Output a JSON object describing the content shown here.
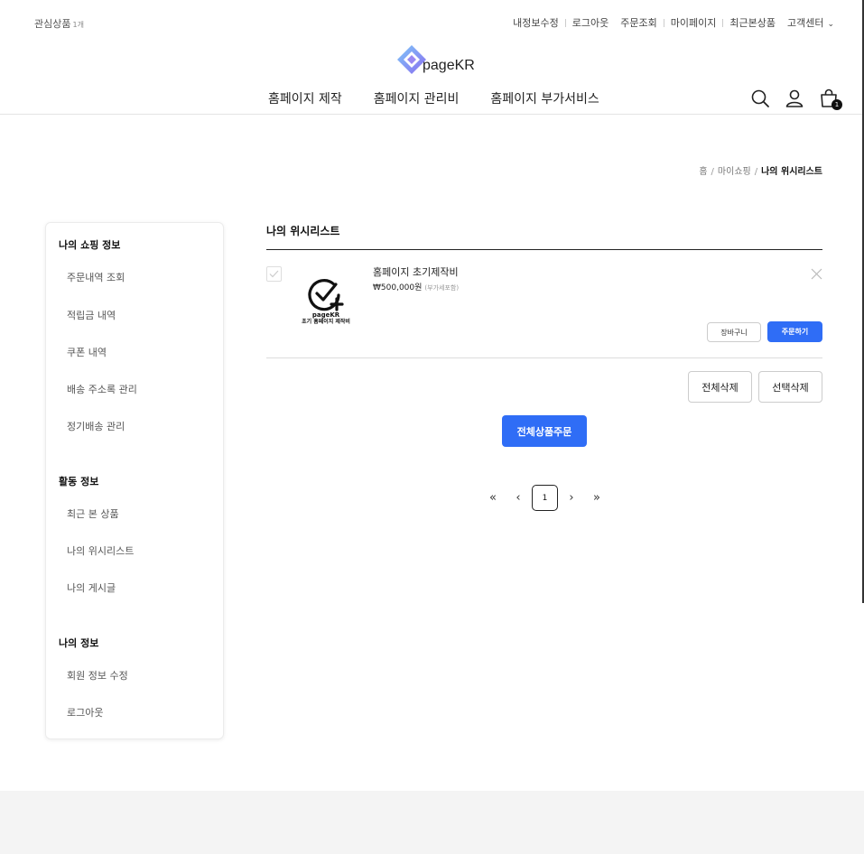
{
  "topbar": {
    "wishlist_label": "관심상품",
    "wishlist_count": "1개",
    "links": [
      "내정보수정",
      "로그아웃",
      "주문조회",
      "마이페이지",
      "최근본상품"
    ],
    "customer_center": "고객센터"
  },
  "logo": {
    "text": "pageKR"
  },
  "gnb": {
    "menus": [
      "홈페이지 제작",
      "홈페이지 관리비",
      "홈페이지 부가서비스"
    ]
  },
  "header_icons": {
    "cart_count": "1"
  },
  "breadcrumb": {
    "home": "홈",
    "mid": "마이쇼핑",
    "current": "나의 위시리스트"
  },
  "sidebar": {
    "sections": [
      {
        "title": "나의 쇼핑 정보",
        "items": [
          "주문내역 조회",
          "적립금 내역",
          "쿠폰 내역",
          "배송 주소록 관리",
          "정기배송 관리"
        ]
      },
      {
        "title": "활동 정보",
        "items": [
          "최근 본 상품",
          "나의 위시리스트",
          "나의 게시글"
        ]
      },
      {
        "title": "나의 정보",
        "items": [
          "회원 정보 수정",
          "로그아웃"
        ]
      }
    ]
  },
  "content": {
    "title": "나의 위시리스트",
    "items": [
      {
        "name": "홈페이지 초기제작비",
        "price": "₩500,000원",
        "vat_note": "(부가세포함)",
        "thumb_line1": "pageKR",
        "thumb_line2": "초기 홈페이지 제작비",
        "cart_button": "장바구니",
        "order_button": "주문하기"
      }
    ],
    "delete_all": "전체삭제",
    "delete_selected": "선택삭제",
    "order_all": "전체상품주문"
  },
  "pagination": {
    "current_page": "1"
  },
  "colors": {
    "accent": "#2f6df6",
    "logo_start": "#7ec8f8",
    "logo_end": "#8a6cf0"
  }
}
